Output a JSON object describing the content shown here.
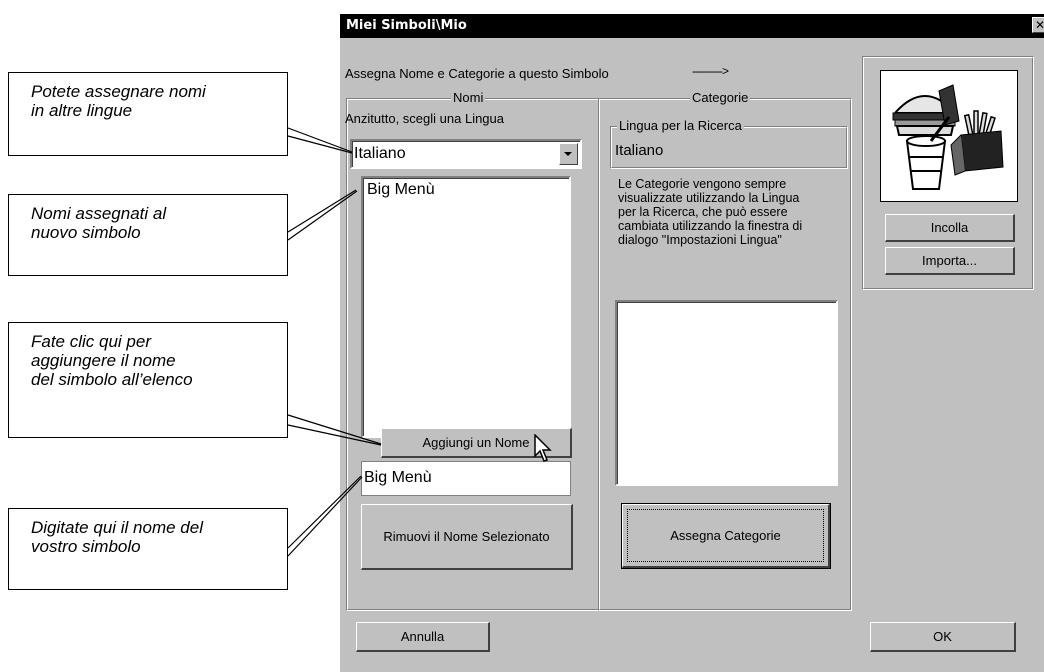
{
  "callouts": [
    {
      "text": "Potete assegnare nomi\nin altre lingue"
    },
    {
      "text": "Nomi assegnati al\nnuovo simbolo"
    },
    {
      "text": "Fate clic qui per\naggiungere il nome\ndel simbolo all’elenco"
    },
    {
      "text": "Digitate qui il nome del\nvostro simbolo"
    }
  ],
  "window": {
    "title": "Miei Simboli\\Mio",
    "close_glyph": "✕",
    "heading": "Assegna Nome e Categorie a questo Simbolo",
    "arrow_text": "---------->"
  },
  "names_panel": {
    "legend": "Nomi",
    "prompt": "Anzitutto, scegli una Lingua",
    "language_selected": "Italiano",
    "names_list": [
      "Big Menù"
    ],
    "add_button": "Aggiungi un Nome",
    "name_input_value": "Big Menù",
    "remove_button": "Rimuovi il Nome Selezionato"
  },
  "categories_panel": {
    "legend": "Categorie",
    "search_language_legend": "Lingua per la Ricerca",
    "search_language_value": "Italiano",
    "info": "Le Categorie vengono sempre\nvisualizzate utilizzando la Lingua\nper la Ricerca, che può essere\ncambiata utilizzando la finestra di\ndialogo \"Impostazioni Lingua\"",
    "assign_button": "Assegna Categorie"
  },
  "image_panel": {
    "image_icon": "burger-fries-drink-icon",
    "paste_button": "Incolla",
    "import_button": "Importa..."
  },
  "footer": {
    "cancel_button": "Annulla",
    "ok_button": "OK"
  }
}
